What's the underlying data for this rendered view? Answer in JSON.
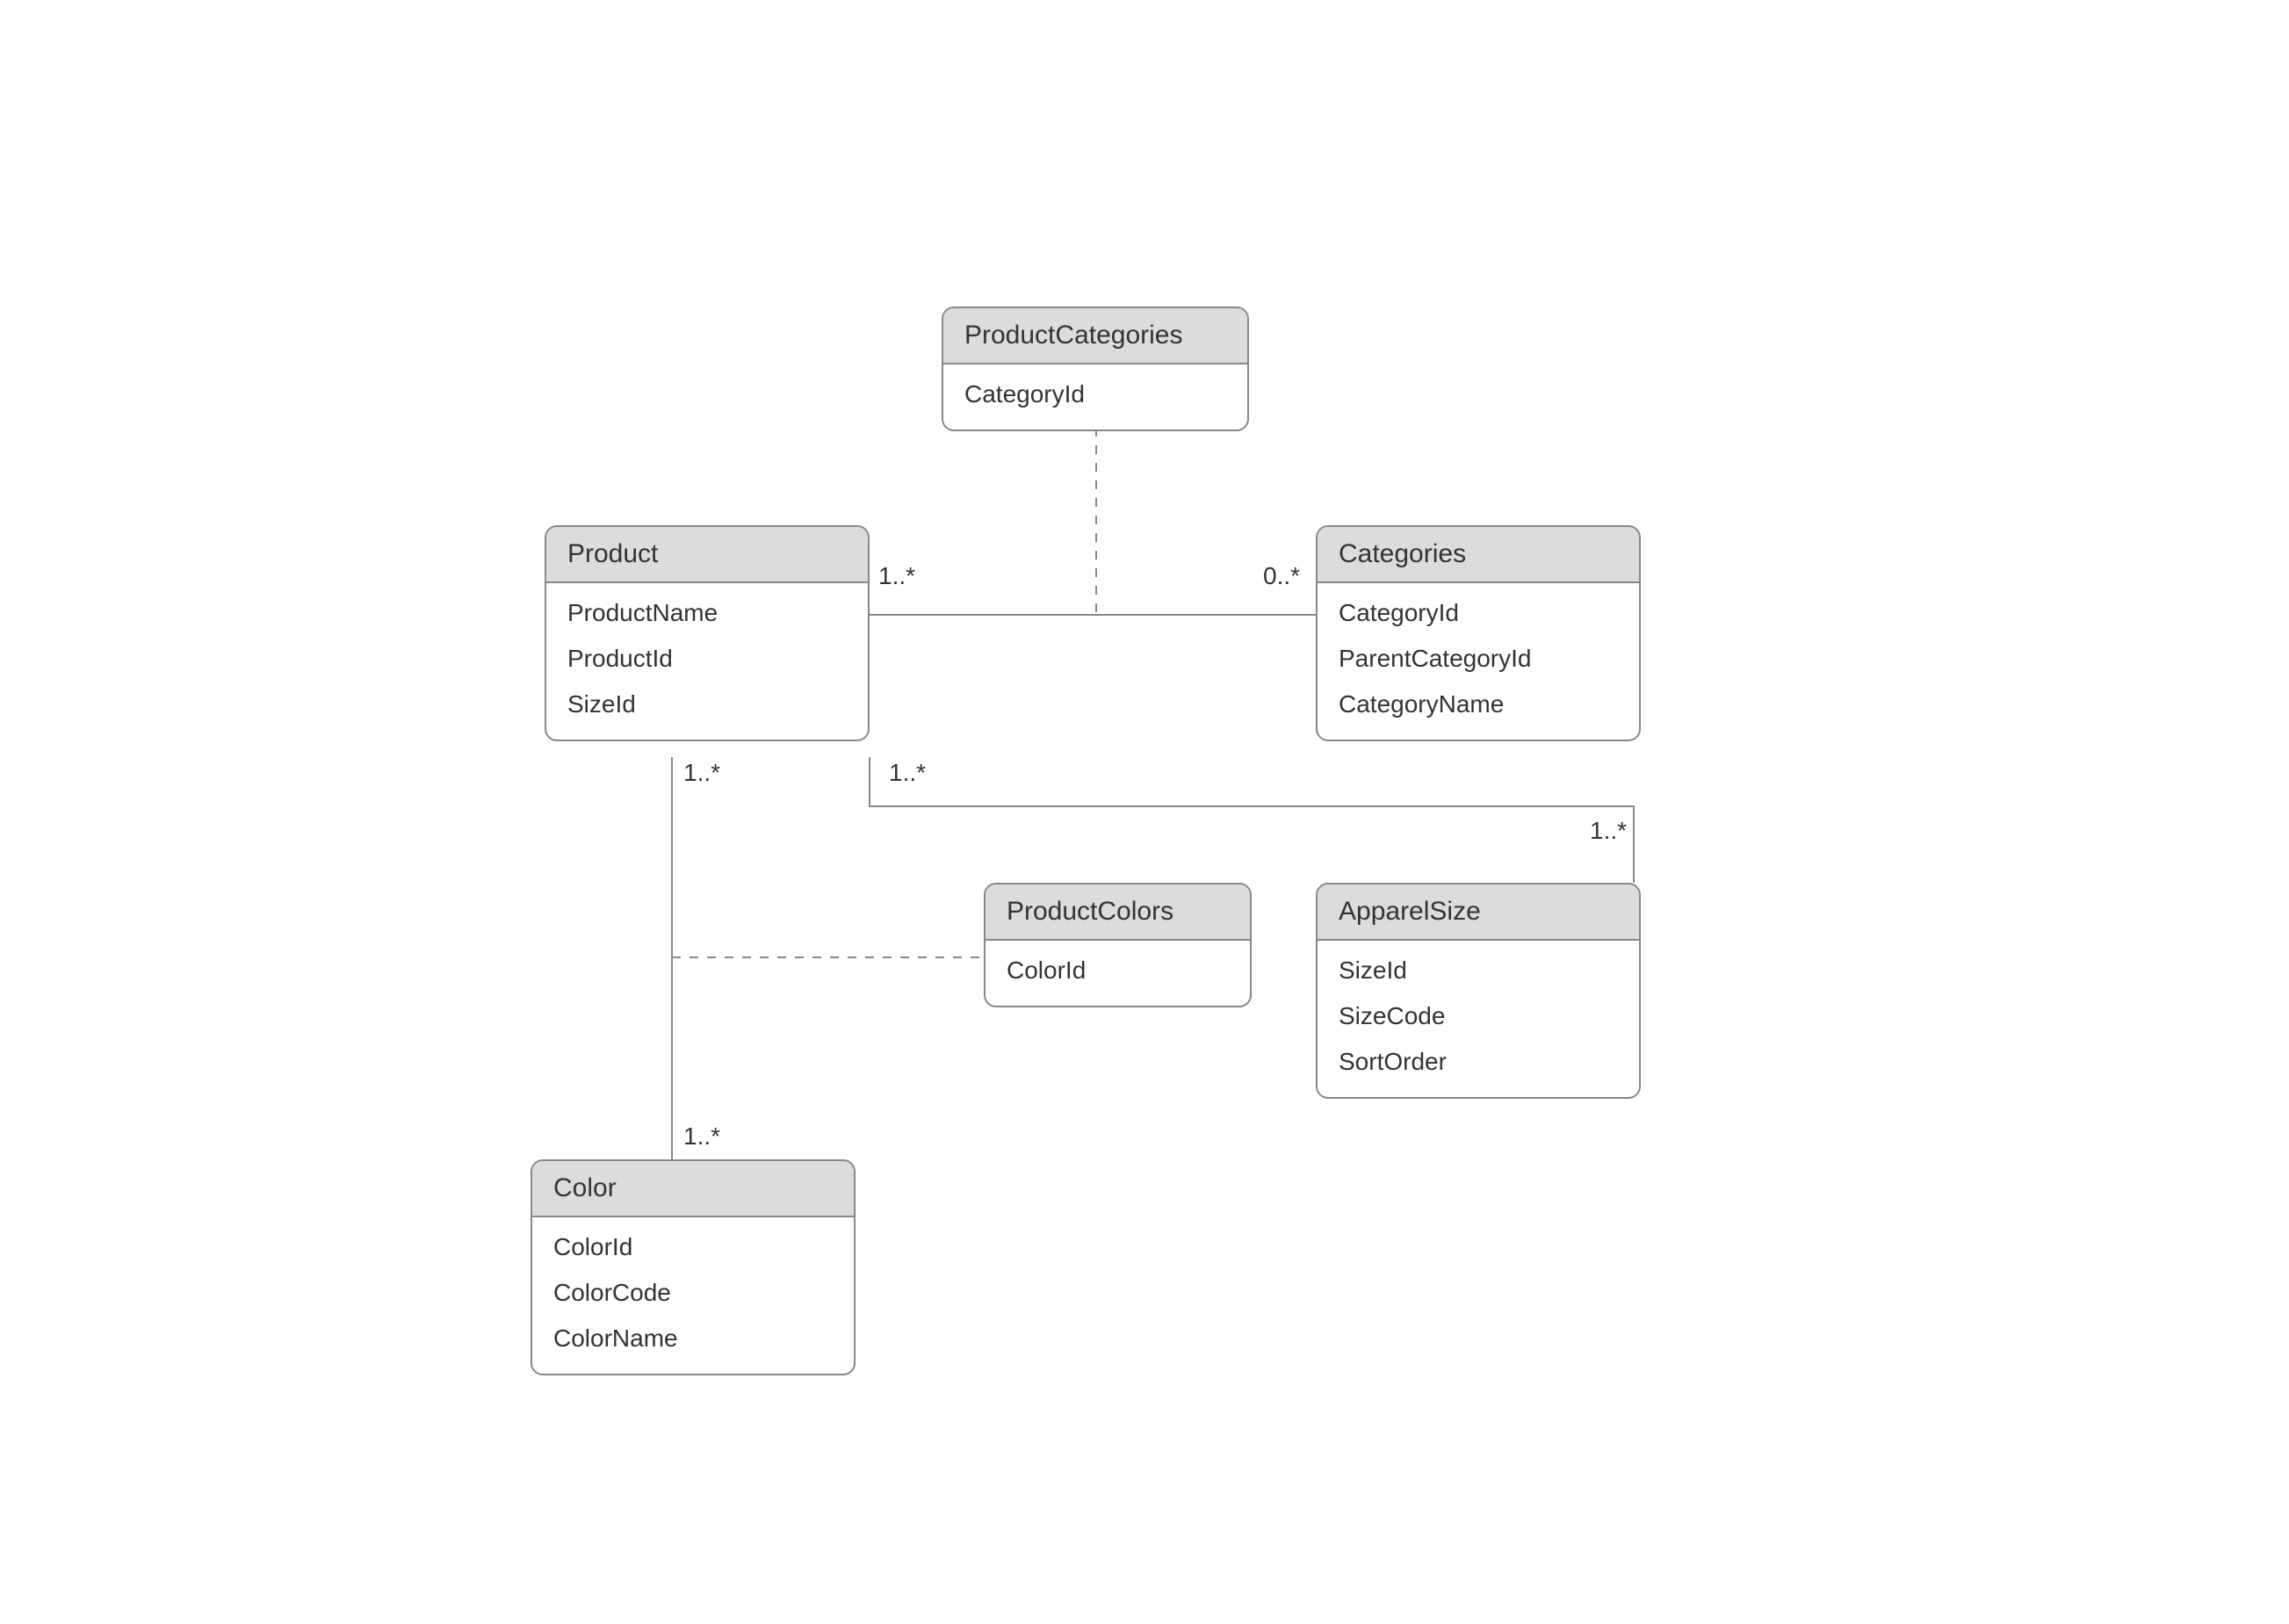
{
  "diagram_type": "UML Class / Entity Diagram",
  "entities": {
    "productCategories": {
      "name": "ProductCategories",
      "attributes": [
        "CategoryId"
      ]
    },
    "product": {
      "name": "Product",
      "attributes": [
        "ProductName",
        "ProductId",
        "SizeId"
      ]
    },
    "categories": {
      "name": "Categories",
      "attributes": [
        "CategoryId",
        "ParentCategoryId",
        "CategoryName"
      ]
    },
    "productColors": {
      "name": "ProductColors",
      "attributes": [
        "ColorId"
      ]
    },
    "apparelSize": {
      "name": "ApparelSize",
      "attributes": [
        "SizeId",
        "SizeCode",
        "SortOrder"
      ]
    },
    "color": {
      "name": "Color",
      "attributes": [
        "ColorId",
        "ColorCode",
        "ColorName"
      ]
    }
  },
  "multiplicities": {
    "product_categories_left": "1..*",
    "product_categories_right": "0..*",
    "product_color_top": "1..*",
    "product_color_bottom": "1..*",
    "product_apparel_left": "1..*",
    "product_apparel_right": "1..*"
  },
  "relationships": [
    {
      "from": "Product",
      "to": "Categories",
      "type": "association",
      "via": "ProductCategories",
      "left_mult": "1..*",
      "right_mult": "0..*"
    },
    {
      "from": "Product",
      "to": "Color",
      "type": "association",
      "via": "ProductColors",
      "top_mult": "1..*",
      "bottom_mult": "1..*"
    },
    {
      "from": "Product",
      "to": "ApparelSize",
      "type": "association",
      "left_mult": "1..*",
      "right_mult": "1..*"
    }
  ]
}
